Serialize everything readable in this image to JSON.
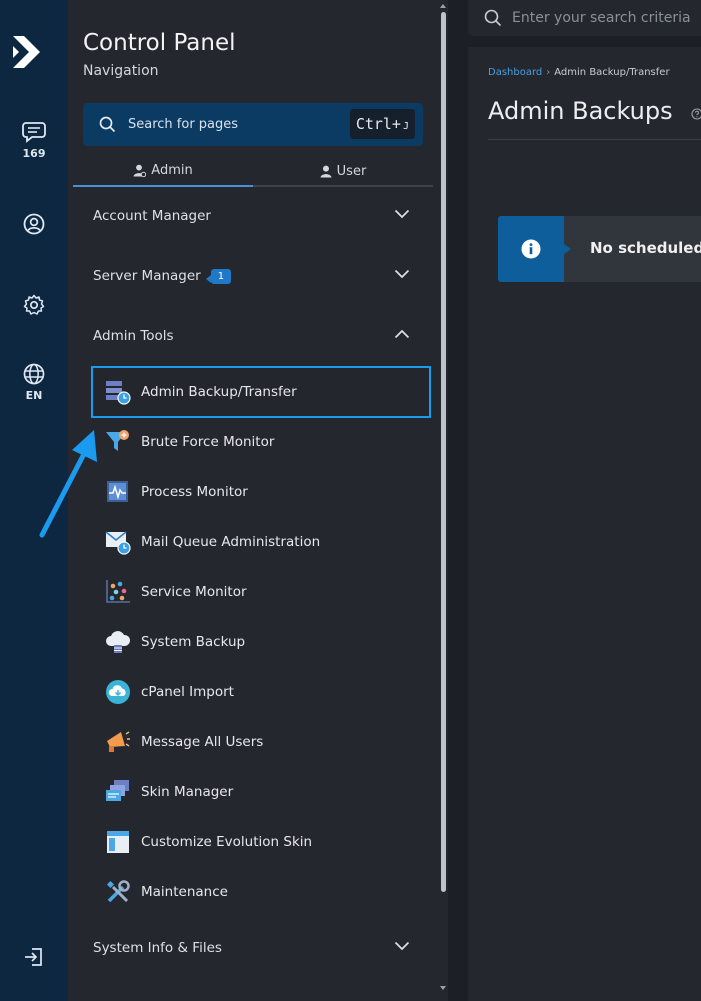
{
  "rail": {
    "messages_count": "169",
    "language": "EN"
  },
  "nav": {
    "title": "Control Panel",
    "subtitle": "Navigation",
    "search_placeholder": "Search for pages",
    "shortcut_main": "Ctrl+",
    "shortcut_key": "J",
    "tabs": [
      {
        "label": "Admin",
        "active": true
      },
      {
        "label": "User",
        "active": false
      }
    ],
    "sections": {
      "account_manager": "Account Manager",
      "server_manager": "Server Manager",
      "server_manager_badge": "1",
      "admin_tools": "Admin Tools",
      "system_info": "System Info & Files"
    },
    "admin_tools_items": [
      {
        "label": "Admin Backup/Transfer",
        "icon": "backup-transfer-icon",
        "selected": true
      },
      {
        "label": "Brute Force Monitor",
        "icon": "brute-force-filter-icon"
      },
      {
        "label": "Process Monitor",
        "icon": "process-monitor-icon"
      },
      {
        "label": "Mail Queue Administration",
        "icon": "mail-queue-icon"
      },
      {
        "label": "Service Monitor",
        "icon": "service-monitor-icon"
      },
      {
        "label": "System Backup",
        "icon": "cloud-backup-icon"
      },
      {
        "label": "cPanel Import",
        "icon": "cloud-import-icon"
      },
      {
        "label": "Message All Users",
        "icon": "megaphone-icon"
      },
      {
        "label": "Skin Manager",
        "icon": "skin-manager-icon"
      },
      {
        "label": "Customize Evolution Skin",
        "icon": "customize-skin-icon"
      },
      {
        "label": "Maintenance",
        "icon": "tools-icon"
      }
    ]
  },
  "topbar": {
    "search_placeholder": "Enter your search criteria"
  },
  "main": {
    "breadcrumb_home": "Dashboard",
    "breadcrumb_current": "Admin Backup/Transfer",
    "title": "Admin Backups",
    "alert_text": "No scheduled"
  },
  "colors": {
    "rail_bg": "#0d2740",
    "panel_bg": "#24272e",
    "accent": "#1a9bf0",
    "search_bg": "#0b3a63",
    "alert_icon_bg": "#0f5e9c"
  }
}
